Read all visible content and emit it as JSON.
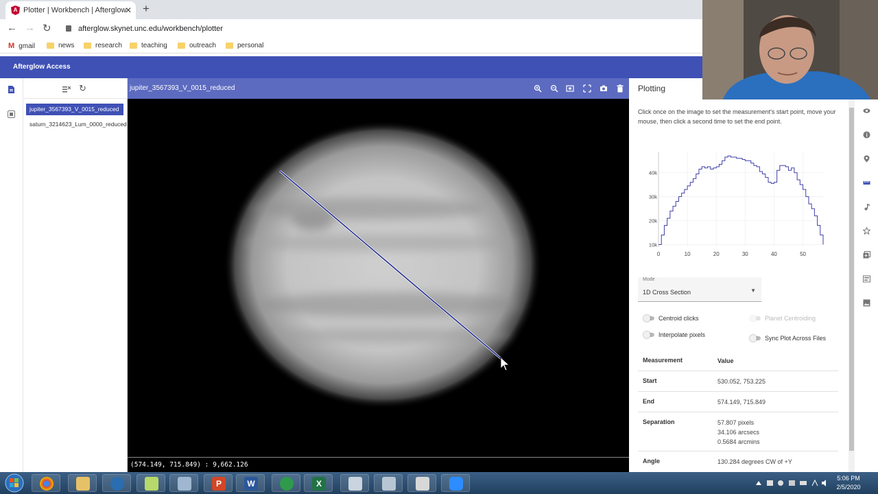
{
  "browser": {
    "tab_title": "Plotter | Workbench | Afterglow",
    "url": "afterglow.skynet.unc.edu/workbench/plotter",
    "bookmarks": [
      "gmail",
      "news",
      "research",
      "teaching",
      "outreach",
      "personal"
    ]
  },
  "app": {
    "title": "Afterglow Access"
  },
  "files": [
    {
      "name": "jupiter_3567393_V_0015_reduced",
      "selected": true
    },
    {
      "name": "saturn_3214623_Lum_0000_reduced",
      "selected": false
    }
  ],
  "viewer": {
    "title": "jupiter_3567393_V_0015_reduced",
    "status": "(574.149, 715.849) : 9,662.126"
  },
  "plotting": {
    "title": "Plotting",
    "instructions": "Click once on the image to set the measurement's start point, move your mouse, then click a second time to set the end point.",
    "mode_label": "Mode",
    "mode_value": "1D Cross Section",
    "toggles": {
      "centroid_clicks": "Centroid clicks",
      "planet_centroiding": "Planet Centroiding",
      "interpolate_pixels": "Interpolate pixels",
      "sync_plot": "Sync Plot Across Files"
    },
    "table_header": {
      "measurement": "Measurement",
      "value": "Value"
    },
    "rows": {
      "start": {
        "label": "Start",
        "value": "530.052, 753.225"
      },
      "end": {
        "label": "End",
        "value": "574.149, 715.849"
      },
      "separation": {
        "label": "Separation",
        "value_px": "57.807 pixels",
        "value_arcsec": "34.106 arcsecs",
        "value_arcmin": "0.5684 arcmins"
      },
      "angle": {
        "label": "Angle",
        "value": "130.284 degrees CW of +Y"
      }
    }
  },
  "chart_data": {
    "type": "line",
    "x": [
      0,
      1,
      2,
      3,
      4,
      5,
      6,
      7,
      8,
      9,
      10,
      11,
      12,
      13,
      14,
      15,
      16,
      17,
      18,
      19,
      20,
      21,
      22,
      23,
      24,
      25,
      26,
      27,
      28,
      29,
      30,
      31,
      32,
      33,
      34,
      35,
      36,
      37,
      38,
      39,
      40,
      41,
      42,
      43,
      44,
      45,
      46,
      47,
      48,
      49,
      50,
      51,
      52,
      53,
      54,
      55,
      56,
      57
    ],
    "y": [
      10000,
      14000,
      18000,
      21000,
      24000,
      26000,
      28000,
      30000,
      31500,
      33000,
      34500,
      36000,
      37500,
      39500,
      41500,
      42500,
      42000,
      42500,
      41500,
      42000,
      42500,
      43500,
      45000,
      46500,
      47000,
      46500,
      46500,
      46000,
      46000,
      45500,
      45000,
      45000,
      44000,
      43000,
      42500,
      40500,
      39500,
      38000,
      36000,
      35500,
      36000,
      41000,
      43000,
      43000,
      42500,
      41000,
      42000,
      40000,
      37000,
      35000,
      33000,
      30000,
      27000,
      25000,
      22000,
      18000,
      14000,
      10000
    ],
    "xticks": [
      "0",
      "10",
      "20",
      "30",
      "40",
      "50"
    ],
    "yticks": [
      "10k",
      "20k",
      "30k",
      "40k"
    ],
    "xlim": [
      0,
      57
    ],
    "ylim": [
      9000,
      48500
    ],
    "line_color": "#3f3faa"
  },
  "taskbar": {
    "apps": [
      "ie-icon",
      "chrome-icon",
      "explorer-icon",
      "thunderbird-icon",
      "folder-icon",
      "paint-icon",
      "powerpoint-icon",
      "word-icon",
      "ds9-icon",
      "excel-icon",
      "snipping-icon",
      "calculator-icon",
      "file-icon",
      "zoom-icon"
    ],
    "time": "5:06 PM",
    "date": "2/5/2020"
  }
}
